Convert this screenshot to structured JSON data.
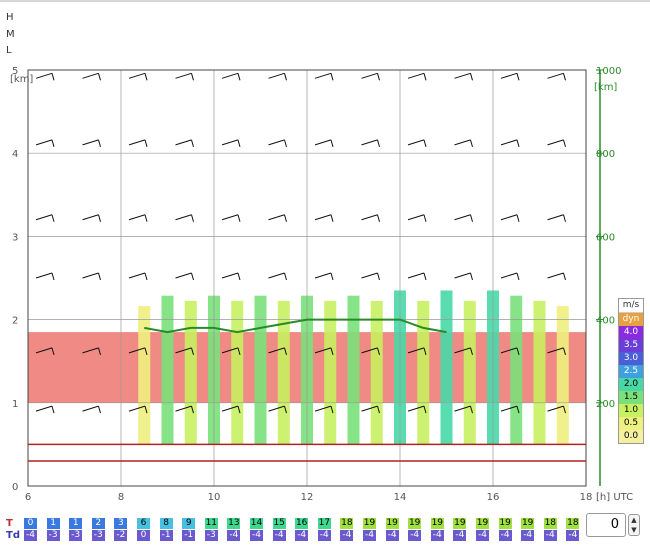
{
  "levels": {
    "high": "H",
    "mid": "M",
    "low": "L"
  },
  "chart_data": {
    "type": "heatmap",
    "title": "",
    "xlabel": "[h] UTC",
    "ylabel_left": "[km]",
    "ylabel_right": "[km]",
    "x_range": [
      6,
      18
    ],
    "y_left_range": [
      0,
      5
    ],
    "x_ticks": [
      "6",
      "8",
      "10",
      "12",
      "14",
      "16",
      "18"
    ],
    "y_left_ticks": [
      "0",
      "1",
      "2",
      "3",
      "4",
      "5"
    ],
    "y_right_ticks": [
      "200",
      "400",
      "600",
      "800",
      "1000"
    ],
    "unit_label": "m/s",
    "legend": {
      "title": "m/s",
      "entries": [
        {
          "label": "dyn",
          "color": "#e8a040"
        },
        {
          "label": "4.0",
          "color": "#8a2be2"
        },
        {
          "label": "3.5",
          "color": "#6a3fd8"
        },
        {
          "label": "3.0",
          "color": "#4a5ed8"
        },
        {
          "label": "2.5",
          "color": "#3fa0e0"
        },
        {
          "label": "2.0",
          "color": "#48d8a8"
        },
        {
          "label": "1.5",
          "color": "#7ae07a"
        },
        {
          "label": "1.0",
          "color": "#c8f060"
        },
        {
          "label": "0.5",
          "color": "#eef080"
        },
        {
          "label": "0.0",
          "color": "#f5f0a0"
        }
      ]
    },
    "boundary_layer_km": [
      1.9,
      1.85,
      1.9,
      1.9,
      1.85,
      1.9,
      1.95,
      2.0,
      2.0,
      2.0,
      1.9,
      1.85
    ],
    "boundary_layer_x": [
      8.5,
      9.0,
      9.5,
      10.0,
      10.5,
      11.0,
      11.5,
      12.0,
      13.0,
      14.0,
      14.5,
      15.0
    ],
    "series": [
      {
        "values": [
          0.5,
          1.5,
          1.0,
          1.5,
          1.0,
          1.5,
          1.0,
          1.5,
          1.0,
          1.5,
          1.0,
          2.0,
          1.0,
          2.0,
          1.0,
          2.0,
          1.5,
          1.0,
          0.5
        ]
      }
    ],
    "cloud_layer_km": [
      [
        1.0,
        1.85
      ]
    ],
    "wind_heights_km": [
      4.9,
      4.1,
      3.2,
      2.5,
      1.6,
      0.9
    ]
  },
  "bottom": {
    "t_label": "T",
    "td_label": "Td",
    "t_values": [
      "0",
      "1",
      "1",
      "2",
      "3",
      "6",
      "8",
      "9",
      "11",
      "13",
      "14",
      "15",
      "16",
      "17",
      "18",
      "19",
      "19",
      "19",
      "19",
      "19",
      "19",
      "19",
      "19",
      "18",
      "18"
    ],
    "td_values": [
      "-4",
      "-3",
      "-3",
      "-3",
      "-2",
      "0",
      "-1",
      "-1",
      "-3",
      "-4",
      "-4",
      "-4",
      "-4",
      "-4",
      "-4",
      "-4",
      "-4",
      "-4",
      "-4",
      "-4",
      "-4",
      "-4",
      "-4",
      "-4",
      "-4"
    ],
    "stepper_value": "0"
  },
  "colors": {
    "cloud": "#f08a84",
    "grid": "#222222",
    "green_axis": "#2a8a2a",
    "t_cell": "#3a7ae0",
    "td_cell": "#6a5acd",
    "red_line": "#b22222"
  }
}
